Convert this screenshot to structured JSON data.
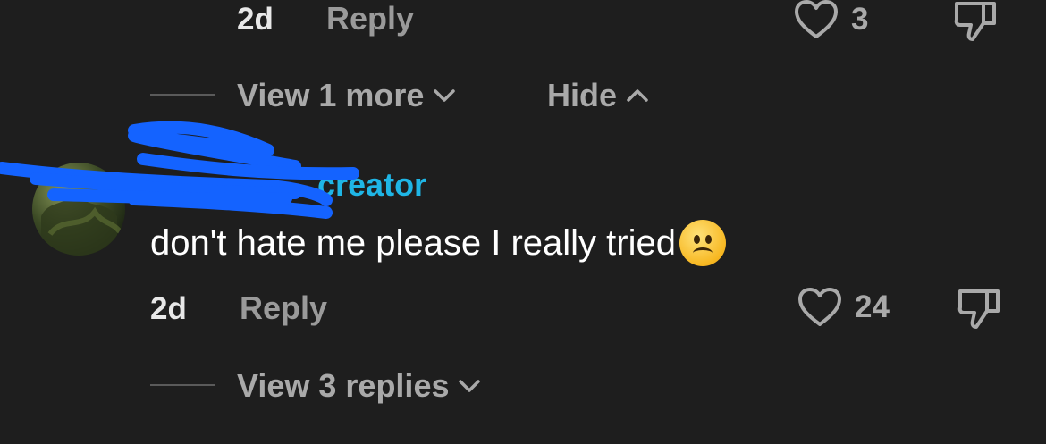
{
  "comment_prev": {
    "time": "2d",
    "reply_label": "Reply",
    "like_count": "3"
  },
  "thread_controls": {
    "view_more_label": "View 1 more",
    "hide_label": "Hide"
  },
  "comment": {
    "username_visible": "creator",
    "text": "don't hate me please I really tried",
    "emoji": "slightly-frowning-face",
    "time": "2d",
    "reply_label": "Reply",
    "like_count": "24",
    "view_replies_label": "View 3 replies"
  },
  "colors": {
    "background": "#1e1e1e",
    "creator_accent": "#1fb6e6",
    "redaction": "#1463ff"
  }
}
